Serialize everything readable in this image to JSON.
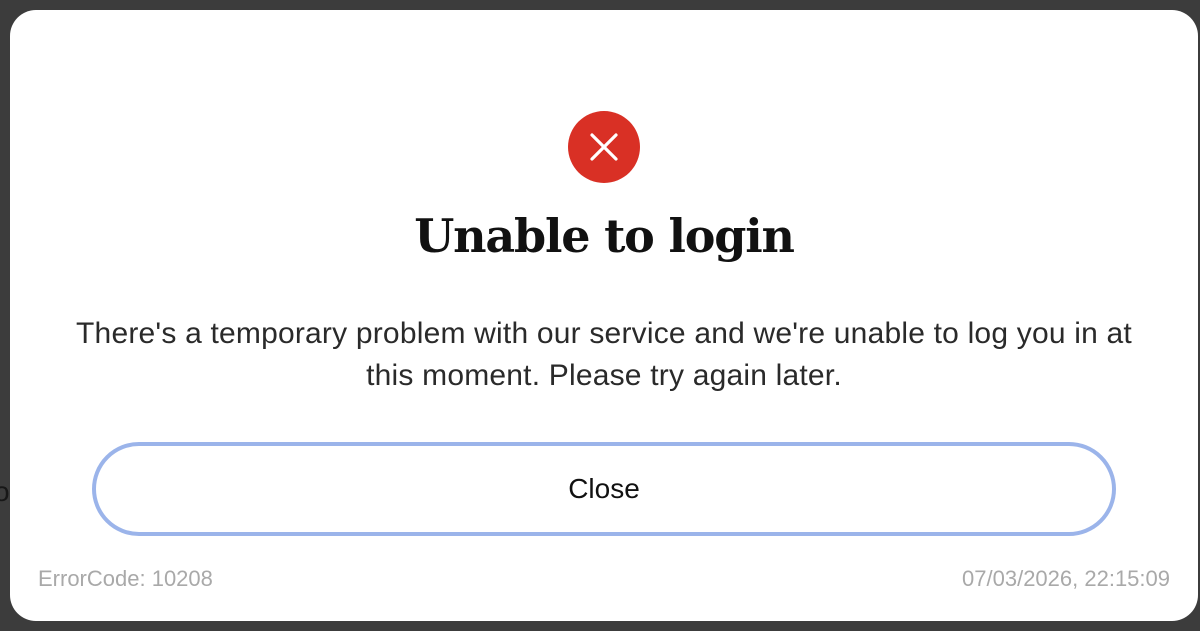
{
  "background": {
    "fragment_text": "o"
  },
  "dialog": {
    "icon": "error-x-circle-icon",
    "icon_color": "#d93025",
    "title": "Unable to login",
    "message": "There's a temporary problem with our service and we're unable to log you in at this moment. Please try again later.",
    "close_button_label": "Close",
    "close_button_border_color": "#9bb4ea",
    "error_code_text": "ErrorCode: 10208",
    "timestamp": "07/03/2026, 22:15:09"
  }
}
